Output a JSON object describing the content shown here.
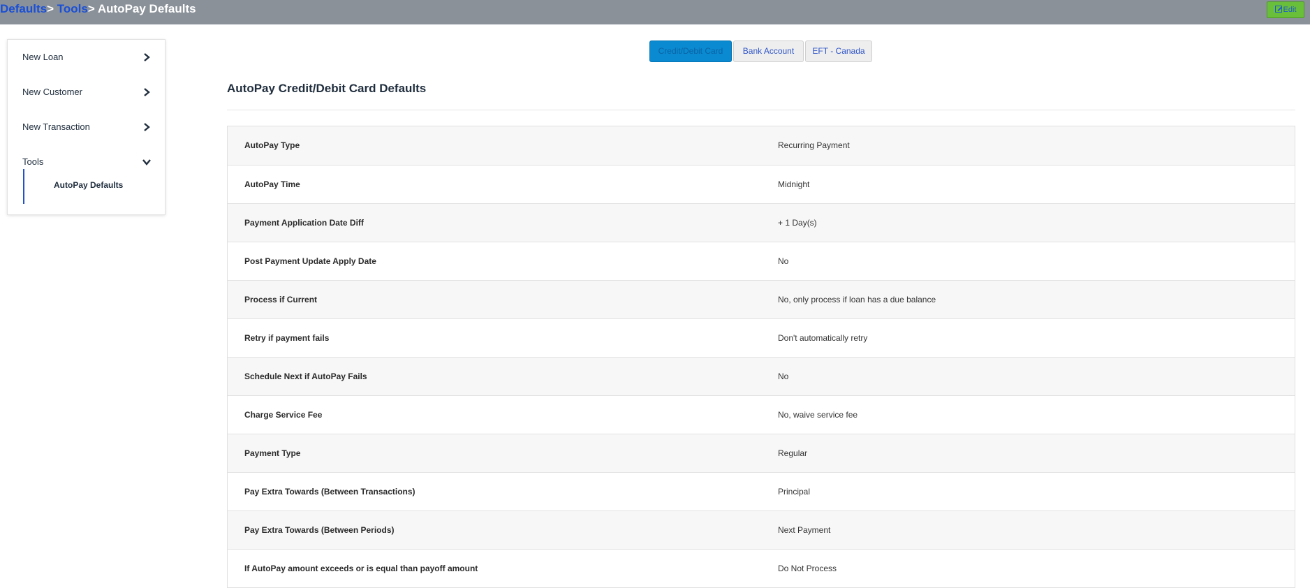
{
  "breadcrumb": {
    "items": [
      "Defaults",
      "Tools"
    ],
    "separator": ">",
    "current": "AutoPay Defaults"
  },
  "header": {
    "edit_label": "Edit",
    "edit_icon": "edit-icon"
  },
  "sidebar": {
    "items": [
      {
        "label": "New Loan",
        "icon": "chevron-right-icon"
      },
      {
        "label": "New Customer",
        "icon": "chevron-right-icon"
      },
      {
        "label": "New Transaction",
        "icon": "chevron-right-icon"
      },
      {
        "label": "Tools",
        "icon": "chevron-down-icon"
      }
    ],
    "sub_items": [
      {
        "label": "AutoPay Defaults"
      }
    ]
  },
  "tabs": [
    {
      "label": "Credit/Debit Card",
      "active": true
    },
    {
      "label": "Bank Account",
      "active": false
    },
    {
      "label": "EFT - Canada",
      "active": false
    }
  ],
  "section": {
    "title": "AutoPay Credit/Debit Card Defaults"
  },
  "settings": [
    {
      "key": "AutoPay Type",
      "value": "Recurring Payment"
    },
    {
      "key": "AutoPay Time",
      "value": "Midnight"
    },
    {
      "key": "Payment Application Date Diff",
      "value": "+ 1 Day(s)"
    },
    {
      "key": "Post Payment Update Apply Date",
      "value": "No"
    },
    {
      "key": "Process if Current",
      "value": "No, only process if loan has a due balance"
    },
    {
      "key": "Retry if payment fails",
      "value": "Don't automatically retry"
    },
    {
      "key": "Schedule Next if AutoPay Fails",
      "value": "No"
    },
    {
      "key": "Charge Service Fee",
      "value": "No, waive service fee"
    },
    {
      "key": "Payment Type",
      "value": "Regular"
    },
    {
      "key": "Pay Extra Towards (Between Transactions)",
      "value": "Principal"
    },
    {
      "key": "Pay Extra Towards (Between Periods)",
      "value": "Next Payment"
    },
    {
      "key": "If AutoPay amount exceeds or is equal than payoff amount",
      "value": "Do Not Process"
    }
  ],
  "colors": {
    "topbar": "#8a9199",
    "link": "#1a4fd6",
    "edit_button": "#6abf3a",
    "active_tab": "#0a8ad0",
    "sidebar_rail": "#2451c8"
  }
}
